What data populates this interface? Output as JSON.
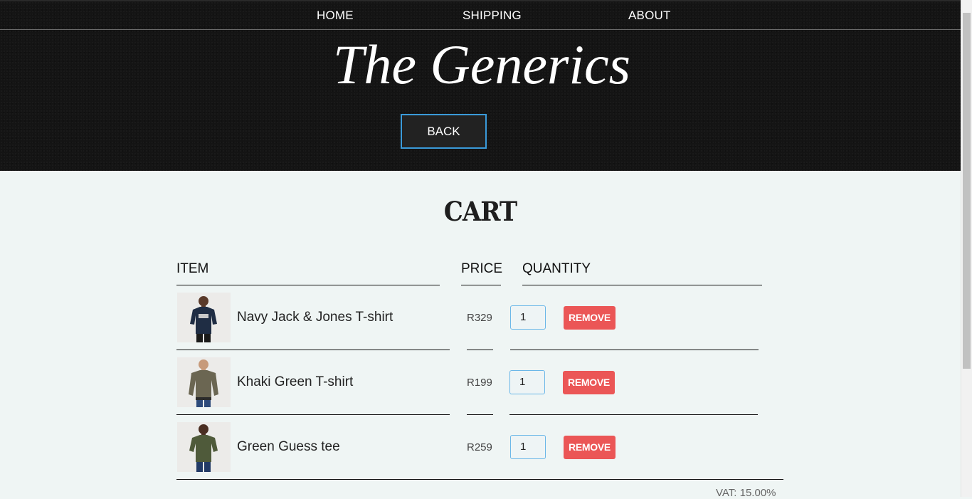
{
  "nav": {
    "home": "HOME",
    "shipping": "SHIPPING",
    "about": "ABOUT"
  },
  "header": {
    "brand": "The Generics",
    "back_label": "BACK"
  },
  "cart": {
    "title": "CART",
    "columns": {
      "item": "ITEM",
      "price": "PRICE",
      "quantity": "QUANTITY"
    },
    "items": [
      {
        "name": "Navy Jack & Jones T-shirt",
        "price": "R329",
        "quantity": "1",
        "remove_label": "REMOVE",
        "shirt_color": "#1f2d44"
      },
      {
        "name": "Khaki Green T-shirt",
        "price": "R199",
        "quantity": "1",
        "remove_label": "REMOVE",
        "shirt_color": "#6b6652"
      },
      {
        "name": "Green Guess tee",
        "price": "R259",
        "quantity": "1",
        "remove_label": "REMOVE",
        "shirt_color": "#4f5a3a"
      }
    ],
    "vat": "VAT: 15.00%"
  },
  "colors": {
    "header_bg": "#141414",
    "accent_border": "#3a9ad9",
    "remove_button": "#eb5656",
    "page_bg": "#eff5f4"
  }
}
